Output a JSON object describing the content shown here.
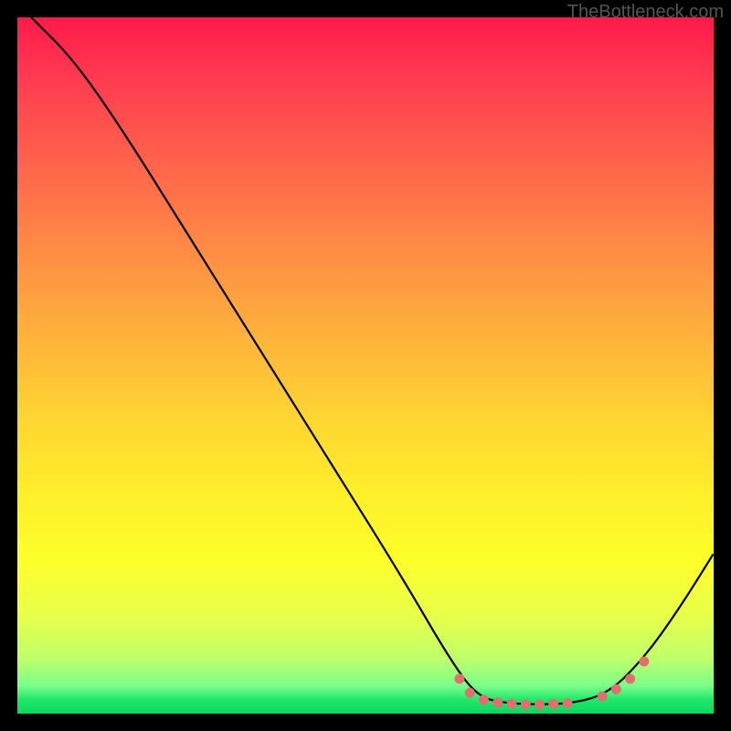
{
  "watermark": "TheBottleneck.com",
  "chart_data": {
    "type": "line",
    "title": "",
    "xlabel": "",
    "ylabel": "",
    "xlim": [
      0,
      100
    ],
    "ylim": [
      0,
      100
    ],
    "curve": [
      {
        "x": 2,
        "y": 100
      },
      {
        "x": 8,
        "y": 94
      },
      {
        "x": 15,
        "y": 84
      },
      {
        "x": 25,
        "y": 68
      },
      {
        "x": 35,
        "y": 52
      },
      {
        "x": 45,
        "y": 36
      },
      {
        "x": 55,
        "y": 20
      },
      {
        "x": 62,
        "y": 8
      },
      {
        "x": 66,
        "y": 2.5
      },
      {
        "x": 70,
        "y": 1.5
      },
      {
        "x": 75,
        "y": 1.3
      },
      {
        "x": 80,
        "y": 1.5
      },
      {
        "x": 85,
        "y": 3
      },
      {
        "x": 90,
        "y": 8
      },
      {
        "x": 95,
        "y": 15
      },
      {
        "x": 100,
        "y": 23
      }
    ],
    "markers": [
      {
        "x": 63.5,
        "y": 5
      },
      {
        "x": 65,
        "y": 3
      },
      {
        "x": 67,
        "y": 2
      },
      {
        "x": 69,
        "y": 1.6
      },
      {
        "x": 71,
        "y": 1.4
      },
      {
        "x": 73,
        "y": 1.3
      },
      {
        "x": 75,
        "y": 1.3
      },
      {
        "x": 77,
        "y": 1.4
      },
      {
        "x": 79,
        "y": 1.5
      },
      {
        "x": 84,
        "y": 2.5
      },
      {
        "x": 86,
        "y": 3.5
      },
      {
        "x": 88,
        "y": 5
      },
      {
        "x": 90,
        "y": 7.5
      }
    ],
    "marker_color": "#e07070",
    "curve_color": "#000000"
  }
}
